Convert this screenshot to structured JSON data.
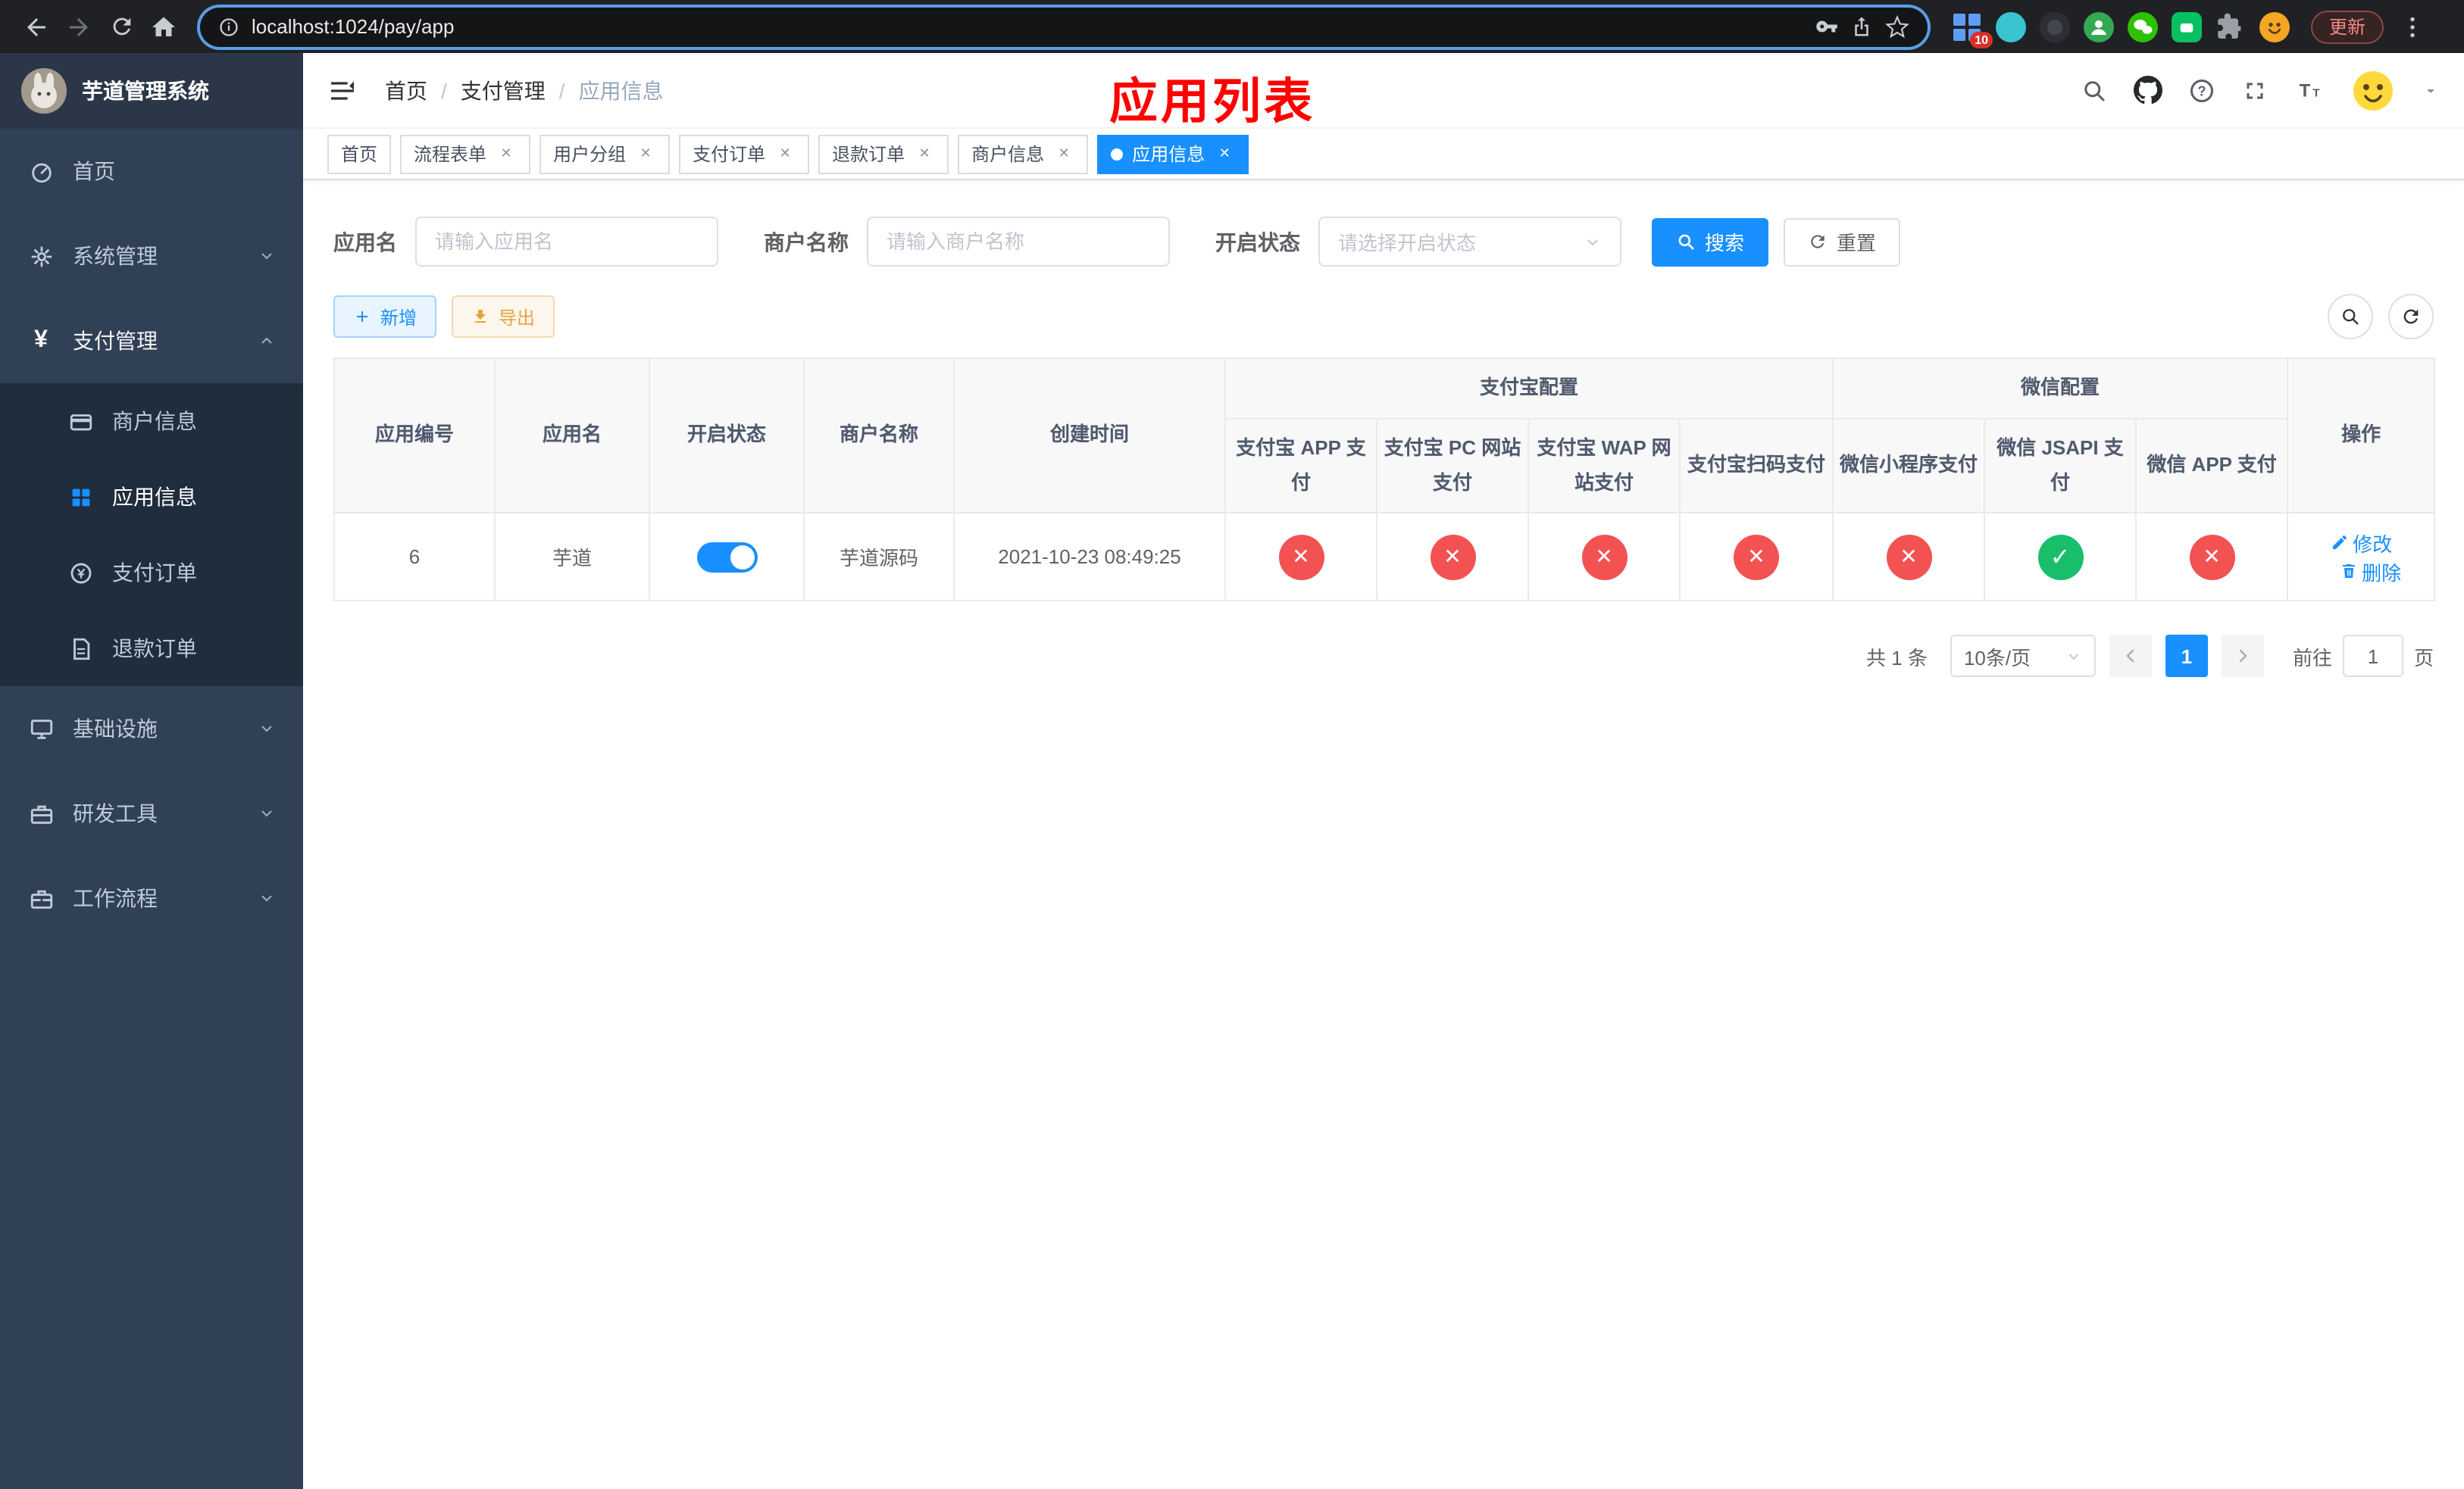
{
  "browser": {
    "url": "localhost:1024/pay/app",
    "update_label": "更新",
    "extension_badge": "10"
  },
  "theme": {
    "primary": "#1890ff",
    "danger": "#f35252",
    "success": "#19be6b",
    "warning": "#e6a23c",
    "sidebar_bg": "#304156",
    "submenu_bg": "#1f2d3d",
    "annotation_red": "#ff0000"
  },
  "sidebar": {
    "app_title": "芋道管理系统",
    "items": [
      {
        "label": "首页"
      },
      {
        "label": "系统管理"
      },
      {
        "label": "支付管理"
      },
      {
        "label": "基础设施"
      },
      {
        "label": "研发工具"
      },
      {
        "label": "工作流程"
      }
    ],
    "submenu": [
      {
        "label": "商户信息"
      },
      {
        "label": "应用信息",
        "active": true
      },
      {
        "label": "支付订单"
      },
      {
        "label": "退款订单"
      }
    ]
  },
  "header": {
    "breadcrumb": [
      "首页",
      "支付管理",
      "应用信息"
    ],
    "annotation_title": "应用列表"
  },
  "tags": [
    {
      "label": "首页"
    },
    {
      "label": "流程表单"
    },
    {
      "label": "用户分组"
    },
    {
      "label": "支付订单"
    },
    {
      "label": "退款订单"
    },
    {
      "label": "商户信息"
    },
    {
      "label": "应用信息"
    }
  ],
  "filters": {
    "app_name_label": "应用名",
    "app_name_placeholder": "请输入应用名",
    "merchant_label": "商户名称",
    "merchant_placeholder": "请输入商户名称",
    "status_label": "开启状态",
    "status_placeholder": "请选择开启状态",
    "search_label": "搜索",
    "reset_label": "重置"
  },
  "toolbar": {
    "add_label": "新增",
    "export_label": "导出"
  },
  "table": {
    "col_id": "应用编号",
    "col_name": "应用名",
    "col_status": "开启状态",
    "col_merchant": "商户名称",
    "col_created": "创建时间",
    "col_actions": "操作",
    "alipay_group": "支付宝配置",
    "alipay_cols": [
      "支付宝 APP 支付",
      "支付宝 PC 网站支付",
      "支付宝 WAP 网站支付",
      "支付宝扫码支付"
    ],
    "wechat_group": "微信配置",
    "wechat_cols": [
      "微信小程序支付",
      "微信 JSAPI 支付",
      "微信 APP 支付"
    ],
    "row": {
      "id": "6",
      "name": "芋道",
      "enabled": true,
      "merchant": "芋道源码",
      "created_at": "2021-10-23 08:49:25",
      "configs": [
        false,
        false,
        false,
        false,
        false,
        true,
        false
      ]
    },
    "actions": {
      "edit": "修改",
      "delete": "删除"
    }
  },
  "pagination": {
    "total_text": "共 1 条",
    "page_size_text": "10条/页",
    "current_page": "1",
    "goto_label": "前往",
    "goto_value": "1",
    "page_unit": "页"
  },
  "icon_names": [
    "back-icon",
    "forward-icon",
    "reload-icon",
    "home-icon",
    "info-icon",
    "key-icon",
    "share-icon",
    "star-icon",
    "extensions-icons",
    "menu-dots-icon",
    "hamburger-icon",
    "search-icon",
    "github-icon",
    "question-icon",
    "fullscreen-icon",
    "font-size-icon",
    "caret-down-icon",
    "dashboard-icon",
    "gear-icon",
    "yen-icon",
    "card-icon",
    "grid-icon",
    "order-icon",
    "refund-icon",
    "monitor-icon",
    "toolbox-icon",
    "plus-icon",
    "download-icon",
    "refresh-icon",
    "edit-icon",
    "delete-icon",
    "check-icon",
    "cross-icon"
  ]
}
